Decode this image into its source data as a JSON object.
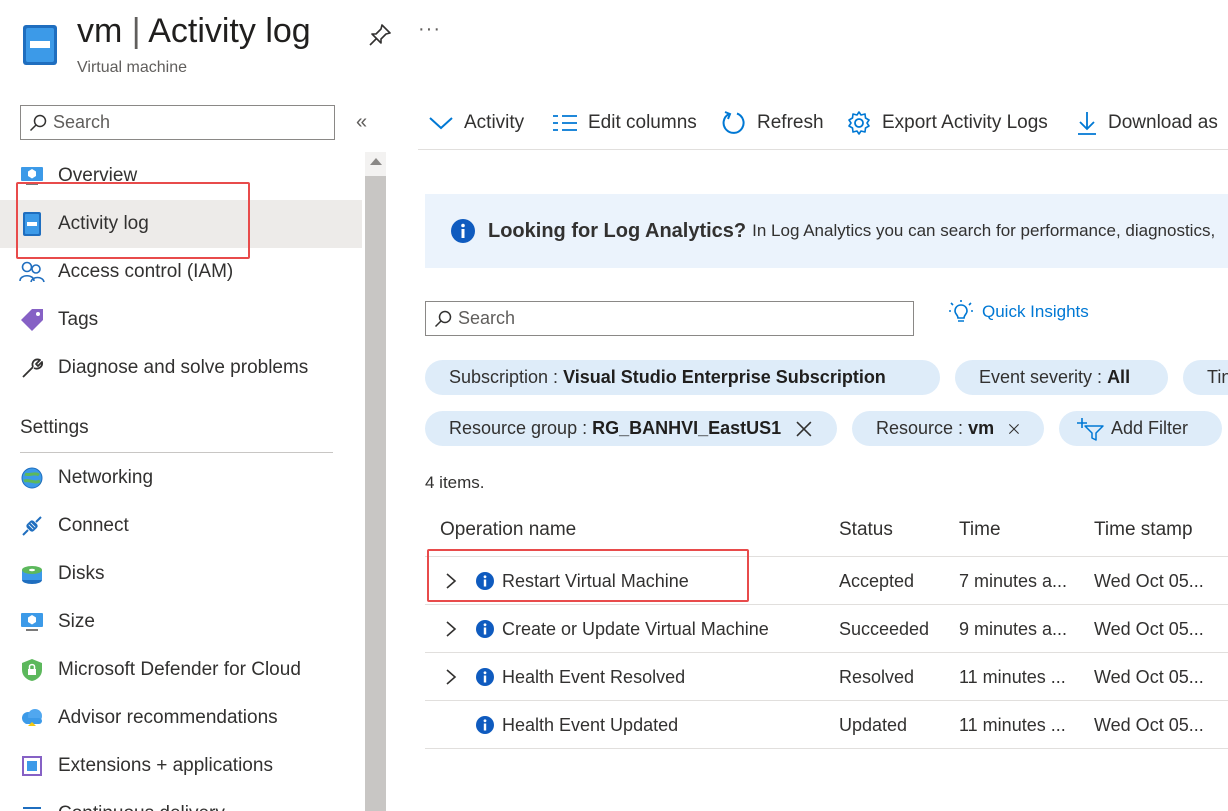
{
  "header": {
    "title_main": "vm",
    "title_sep": "|",
    "title_page": "Activity log",
    "subtitle": "Virtual machine",
    "more": "···"
  },
  "sidebar": {
    "search_placeholder": "Search",
    "collapse": "«",
    "items": [
      {
        "label": "Overview",
        "icon": "overview-icon"
      },
      {
        "label": "Activity log",
        "icon": "activity-log-icon",
        "active": true
      },
      {
        "label": "Access control (IAM)",
        "icon": "people-icon"
      },
      {
        "label": "Tags",
        "icon": "tag-icon"
      },
      {
        "label": "Diagnose and solve problems",
        "icon": "wrench-icon"
      }
    ],
    "section_settings": "Settings",
    "settings_items": [
      {
        "label": "Networking",
        "icon": "globe-icon"
      },
      {
        "label": "Connect",
        "icon": "plug-icon"
      },
      {
        "label": "Disks",
        "icon": "disk-icon"
      },
      {
        "label": "Size",
        "icon": "monitor-icon"
      },
      {
        "label": "Microsoft Defender for Cloud",
        "icon": "shield-icon"
      },
      {
        "label": "Advisor recommendations",
        "icon": "cloud-icon"
      },
      {
        "label": "Extensions + applications",
        "icon": "extension-icon"
      },
      {
        "label": "Continuous delivery",
        "icon": "delivery-icon"
      }
    ]
  },
  "toolbar": {
    "activity": "Activity",
    "edit_columns": "Edit columns",
    "refresh": "Refresh",
    "export": "Export Activity Logs",
    "download": "Download as"
  },
  "banner": {
    "title": "Looking for Log Analytics?",
    "text": "In Log Analytics you can search for performance, diagnostics,"
  },
  "search": {
    "placeholder": "Search",
    "quick_insights": "Quick Insights"
  },
  "filters": {
    "subscription_label": "Subscription :",
    "subscription_value": "Visual Studio Enterprise Subscription",
    "severity_label": "Event severity :",
    "severity_value": "All",
    "timespan_label": "Tin",
    "rg_label": "Resource group :",
    "rg_value": "RG_BANHVI_EastUS1",
    "resource_label": "Resource :",
    "resource_value": "vm",
    "add_filter": "Add Filter"
  },
  "count": "4 items.",
  "table": {
    "columns": [
      "Operation name",
      "Status",
      "Time",
      "Time stamp"
    ],
    "rows": [
      {
        "op": "Restart Virtual Machine",
        "status": "Accepted",
        "time": "7 minutes a...",
        "stamp": "Wed Oct 05...",
        "expandable": true
      },
      {
        "op": "Create or Update Virtual Machine",
        "status": "Succeeded",
        "time": "9 minutes a...",
        "stamp": "Wed Oct 05...",
        "expandable": true
      },
      {
        "op": "Health Event Resolved",
        "status": "Resolved",
        "time": "11 minutes ...",
        "stamp": "Wed Oct 05...",
        "expandable": true
      },
      {
        "op": "Health Event Updated",
        "status": "Updated",
        "time": "11 minutes ...",
        "stamp": "Wed Oct 05...",
        "expandable": false
      }
    ]
  },
  "colors": {
    "accent": "#0078d4",
    "highlight": "#e84b4b",
    "pill": "#deecf9",
    "banner": "#ebf3fc"
  }
}
